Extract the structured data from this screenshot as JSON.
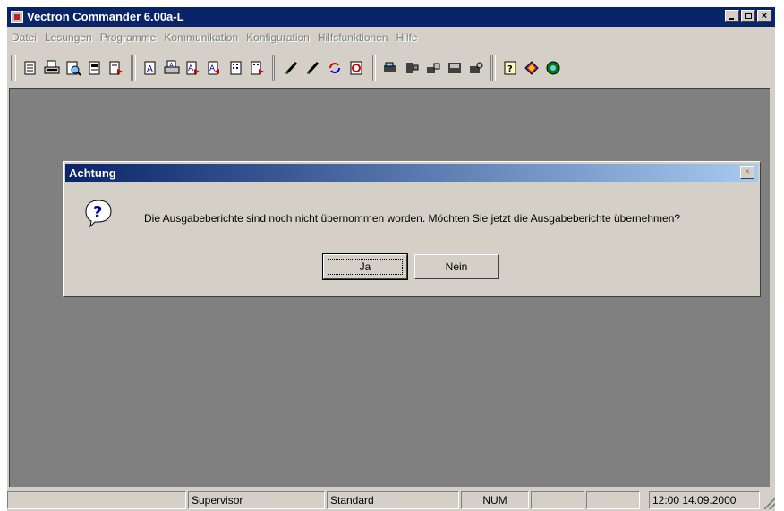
{
  "window": {
    "title": "Vectron Commander 6.00a-L",
    "min_label": "",
    "max_label": "",
    "close_label": "×"
  },
  "menu": [
    "Datei",
    "Lesungen",
    "Programme",
    "Kommunikation",
    "Konfiguration",
    "Hilfsfunktionen",
    "Hilfe"
  ],
  "toolbar_icons": [
    "report-icon",
    "print-report-icon",
    "preview-report-icon",
    "edit-report-icon",
    "export-report-icon",
    "text-a-icon",
    "print-a-icon",
    "export-a-icon",
    "export-a2-icon",
    "data-grid-icon",
    "data-grid-export-icon",
    "pen-icon",
    "pen-alt-icon",
    "refresh-icon",
    "sync-icon",
    "register-icon",
    "settings-icon",
    "tools-icon",
    "cash-register-icon",
    "config-icon",
    "help-icon",
    "book-icon",
    "about-icon"
  ],
  "dialog": {
    "title": "Achtung",
    "close_label": "×",
    "message": "Die Ausgabeberichte sind noch nicht übernommen worden. Möchten Sie jetzt die Ausgabeberichte übernehmen?",
    "yes_label": "Ja",
    "no_label": "Nein"
  },
  "status": {
    "user": "Supervisor",
    "profile": "Standard",
    "num": "NUM",
    "datetime": "12:00  14.09.2000"
  }
}
